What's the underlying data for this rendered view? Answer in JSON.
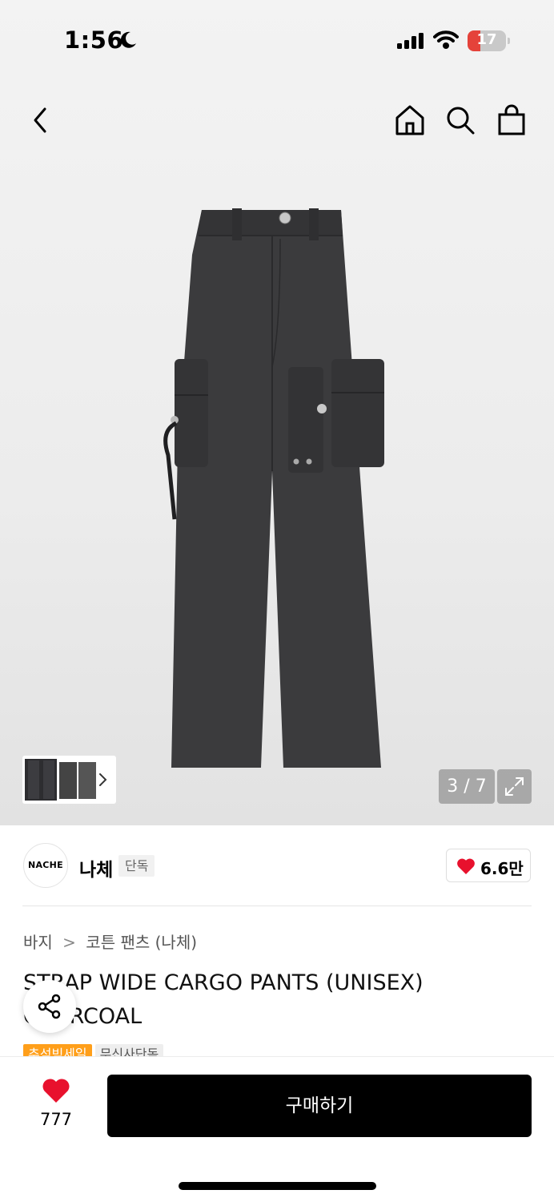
{
  "status_bar": {
    "time": "1:56",
    "battery": "17"
  },
  "gallery": {
    "counter": "3 / 7"
  },
  "brand": {
    "logo_text": "NACHE",
    "name": "나체",
    "badge": "단독",
    "like_count": "6.6만"
  },
  "breadcrumb": {
    "category": "바지",
    "separator": ">",
    "subcategory": "코튼 팬츠 (나체)"
  },
  "product": {
    "title": "STRAP WIDE CARGO PANTS (UNISEX) CHARCOAL"
  },
  "tags": [
    "추석빅세일",
    "무신사단독"
  ],
  "bottom_bar": {
    "fav_count": "777",
    "buy_label": "구매하기"
  },
  "colors": {
    "accent_red": "#e8112d",
    "sale_orange": "#ff9f1a",
    "button_black": "#000000"
  },
  "icons": [
    "moon-icon",
    "signal-icon",
    "wifi-icon",
    "back-icon",
    "home-icon",
    "search-icon",
    "bag-icon",
    "chevron-right-icon",
    "expand-icon",
    "heart-icon",
    "share-icon"
  ]
}
